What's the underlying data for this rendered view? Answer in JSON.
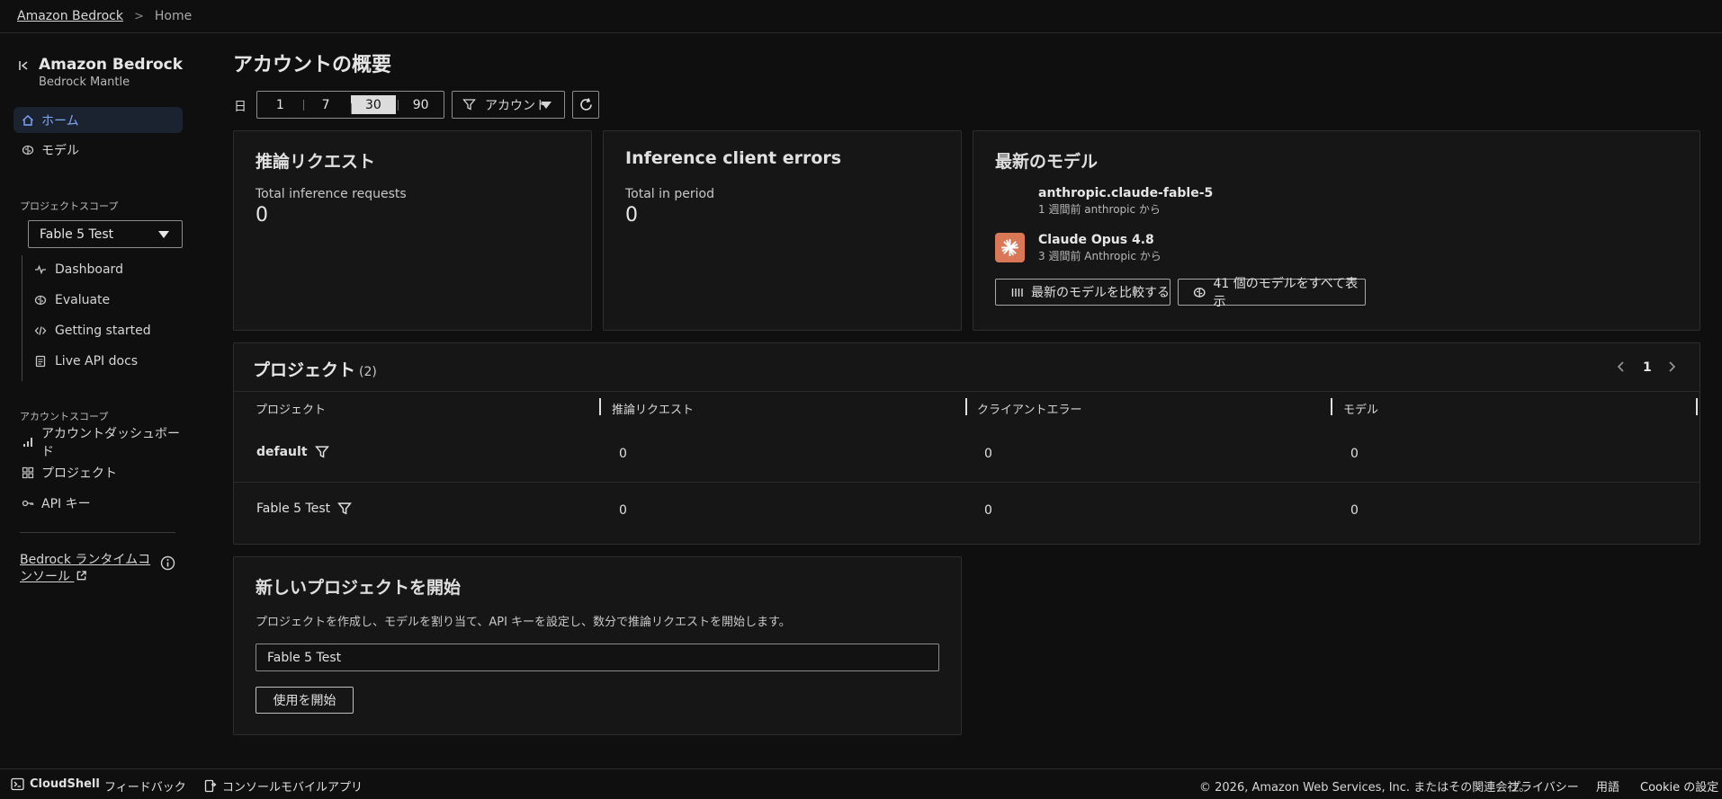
{
  "breadcrumb": {
    "root": "Amazon Bedrock",
    "current": "Home"
  },
  "sidebar": {
    "title": "Amazon Bedrock",
    "subtitle": "Bedrock Mantle",
    "nav": [
      {
        "label": "ホーム",
        "icon": "home-icon",
        "active": true
      },
      {
        "label": "モデル",
        "icon": "brain-icon"
      }
    ],
    "project_scope_label": "プロジェクトスコープ",
    "project_select": "Fable 5 Test",
    "project_items": [
      {
        "label": "Dashboard",
        "icon": "pulse-icon"
      },
      {
        "label": "Evaluate",
        "icon": "brain-icon"
      },
      {
        "label": "Getting started",
        "icon": "code-icon"
      },
      {
        "label": "Live API docs",
        "icon": "document-icon"
      }
    ],
    "account_scope_label": "アカウントスコープ",
    "account_items": [
      {
        "label": "アカウントダッシュボード",
        "icon": "bar-chart-icon"
      },
      {
        "label": "プロジェクト",
        "icon": "grid-icon"
      },
      {
        "label": "API キー",
        "icon": "key-icon"
      }
    ],
    "runtime_console": "Bedrock ランタイムコンソール"
  },
  "main": {
    "title": "アカウントの概要",
    "range_label": "日",
    "range_options": [
      "1",
      "7",
      "30",
      "90"
    ],
    "range_selected": "30",
    "account_filter": "アカウント"
  },
  "cards": {
    "inference": {
      "title": "推論リクエスト",
      "label": "Total inference requests",
      "value": "0"
    },
    "errors": {
      "title": "Inference client errors",
      "label": "Total in period",
      "value": "0"
    },
    "latest": {
      "title": "最新のモデル",
      "models": [
        {
          "name": "anthropic.claude-fable-5",
          "meta": "1 週間前 anthropic から"
        },
        {
          "name": "Claude Opus 4.8",
          "meta": "3 週間前 Anthropic から"
        }
      ],
      "compare_button": "最新のモデルを比較する",
      "view_all_button": "41 個のモデルをすべて表示"
    }
  },
  "projects": {
    "title": "プロジェクト",
    "count": "(2)",
    "page": "1",
    "columns": [
      "プロジェクト",
      "推論リクエスト",
      "クライアントエラー",
      "モデル"
    ],
    "rows": [
      {
        "name": "default",
        "requests": "0",
        "errors": "0",
        "models": "0"
      },
      {
        "name": "Fable 5 Test",
        "requests": "0",
        "errors": "0",
        "models": "0"
      }
    ]
  },
  "new_project": {
    "title": "新しいプロジェクトを開始",
    "description": "プロジェクトを作成し、モデルを割り当て、API キーを設定し、数分で推論リクエストを開始します。",
    "input_value": "Fable 5 Test",
    "start_button": "使用を開始"
  },
  "footer": {
    "cloudshell": "CloudShell",
    "feedback": "フィードバック",
    "mobile_app": "コンソールモバイルアプリ",
    "copyright": "© 2026, Amazon Web Services, Inc. またはその関連会社。",
    "privacy": "プライバシー",
    "terms": "用語",
    "cookie": "Cookie の設定"
  },
  "colors": {
    "accent": "#7ea7ff",
    "active_bg": "#1c2330",
    "claude_logo": "#d97757"
  }
}
